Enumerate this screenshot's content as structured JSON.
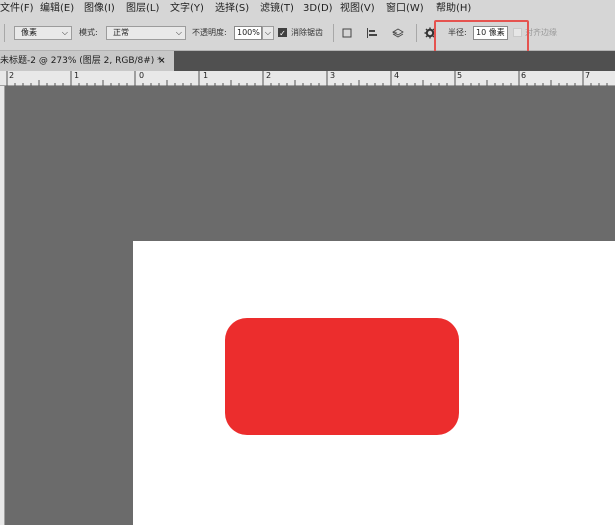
{
  "menu": [
    {
      "label": "文件(F)"
    },
    {
      "label": "编辑(E)"
    },
    {
      "label": "图像(I)"
    },
    {
      "label": "图层(L)"
    },
    {
      "label": "文字(Y)"
    },
    {
      "label": "选择(S)"
    },
    {
      "label": "滤镜(T)"
    },
    {
      "label": "3D(D)"
    },
    {
      "label": "视图(V)"
    },
    {
      "label": "窗口(W)"
    },
    {
      "label": "帮助(H)"
    }
  ],
  "options": {
    "pixels_select": "像素",
    "mode_label": "模式:",
    "mode_value": "正常",
    "opacity_label": "不透明度:",
    "opacity_value": "100%",
    "antialias_label": "消除锯齿",
    "radius_label": "半径:",
    "radius_value": "10 像素",
    "align_edges_label": "对齐边缘"
  },
  "tab": {
    "title": "未标题-2 @ 273% (图层 2, RGB/8#) *",
    "close": "×"
  },
  "ruler": {
    "labels": [
      "2",
      "1",
      "0",
      "1",
      "2",
      "3",
      "4",
      "5",
      "6",
      "7"
    ]
  },
  "colors": {
    "shape_fill": "#ec2d2d",
    "highlight": "#e5534f",
    "workspace": "#6b6b6b",
    "canvas": "#ffffff"
  }
}
